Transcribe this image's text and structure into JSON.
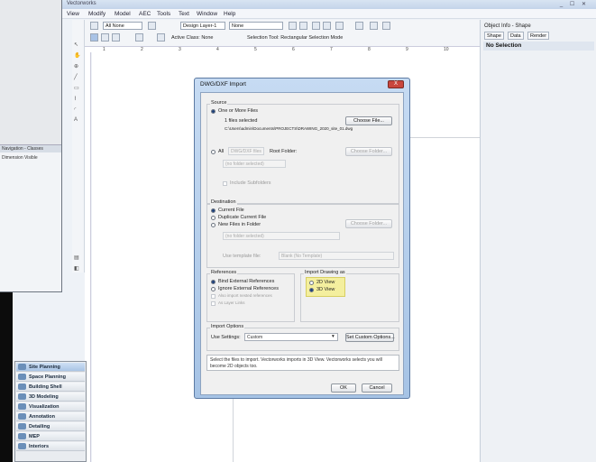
{
  "window": {
    "title": "Vectorworks",
    "controls": "_ ☐ ✕"
  },
  "menubar": {
    "items": [
      "View",
      "Modify",
      "Model",
      "AEC",
      "Tools",
      "Text",
      "Window",
      "Help"
    ]
  },
  "toolbar": {
    "field1": "All None",
    "field2": "Design Layer-1",
    "field3": "None",
    "label1": "Active Class: None",
    "label2": "Selection Tool: Rectangular Selection Mode",
    "ruler_marks": [
      "1",
      "2",
      "3",
      "4",
      "5",
      "6",
      "7",
      "8",
      "9",
      "10"
    ]
  },
  "object_info": {
    "header": "Object Info - Shape",
    "tabs": [
      "Shape",
      "Data",
      "Render"
    ],
    "selection": "No Selection"
  },
  "navigation": {
    "bar": "Navigation - Classes",
    "row": "Dimension   Visible"
  },
  "workspaces": {
    "items": [
      {
        "label": "Site Planning",
        "active": true
      },
      {
        "label": "Space Planning",
        "active": false
      },
      {
        "label": "Building Shell",
        "active": false
      },
      {
        "label": "3D Modeling",
        "active": false
      },
      {
        "label": "Visualization",
        "active": false
      },
      {
        "label": "Annotation",
        "active": false
      },
      {
        "label": "Detailing",
        "active": false
      },
      {
        "label": "MEP",
        "active": false
      },
      {
        "label": "Interiors",
        "active": false
      }
    ]
  },
  "dialog": {
    "title": "DWG/DXF Import",
    "close_label": "X",
    "source": {
      "caption": "Source",
      "one_file": "One or More Files",
      "choose_file_btn": "Choose File...",
      "files_selected": "1 files selected",
      "file_path": "C:\\Users\\admin\\Documents\\PROJECTS\\DRAWING_2020_site_01.dwg",
      "all_label": "All",
      "all_field": "DWG/DXF files",
      "in_folder": "Root Folder:",
      "choose_folder_btn": "Choose Folder...",
      "folder_field": "(no folder selected)",
      "include_subfolders": "Include Subfolders"
    },
    "destination": {
      "caption": "Destination",
      "current_file": "Current File",
      "duplicate": "Duplicate Current File",
      "new_files": "New Files in Folder",
      "choose_folder_btn": "Choose Folder...",
      "folder_field": "(no folder selected)",
      "template_label": "Use template file:",
      "template_value": "Blank (No Template)"
    },
    "references": {
      "caption": "References",
      "bind": "Bind External References",
      "ignore": "Ignore External References",
      "also_import": "Also import nested references",
      "as_layers": "As Layer Links"
    },
    "import_as": {
      "caption": "Import Drawing as",
      "opt2d": "2D View",
      "opt3d": "3D View"
    },
    "import_options": {
      "caption": "Import Options",
      "settings_label": "Use Settings:",
      "settings_value": "Custom",
      "custom_btn": "Set Custom Options..."
    },
    "help_text": "Select the files to import. Vectorworks imports in 3D View. Vectorworks selects you will become 2D objects too.",
    "ok_btn": "OK",
    "cancel_btn": "Cancel"
  }
}
